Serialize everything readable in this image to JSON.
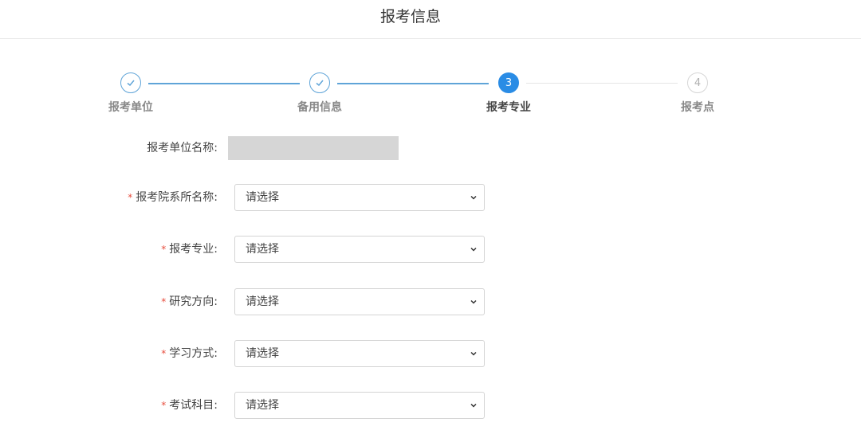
{
  "header": {
    "title": "报考信息"
  },
  "steps": [
    {
      "label": "报考单位",
      "status": "done",
      "icon": "check-icon"
    },
    {
      "label": "备用信息",
      "status": "done",
      "icon": "check-icon"
    },
    {
      "label": "报考专业",
      "status": "active",
      "number": "3"
    },
    {
      "label": "报考点",
      "status": "todo",
      "number": "4"
    }
  ],
  "form": {
    "unit": {
      "label": "报考单位名称:",
      "value": ""
    },
    "department": {
      "label": "报考院系所名称:",
      "value": "请选择",
      "required": "*"
    },
    "major": {
      "label": "报考专业:",
      "value": "请选择",
      "required": "*"
    },
    "direction": {
      "label": "研究方向:",
      "value": "请选择",
      "required": "*"
    },
    "study_mode": {
      "label": "学习方式:",
      "value": "请选择",
      "required": "*"
    },
    "exam_subjects": {
      "label": "考试科目:",
      "value": "请选择",
      "required": "*"
    }
  },
  "colors": {
    "active": "#2a8ce5",
    "done": "#5fa4d8",
    "required": "#e74c3c",
    "redacted": "#d6d6d6"
  }
}
